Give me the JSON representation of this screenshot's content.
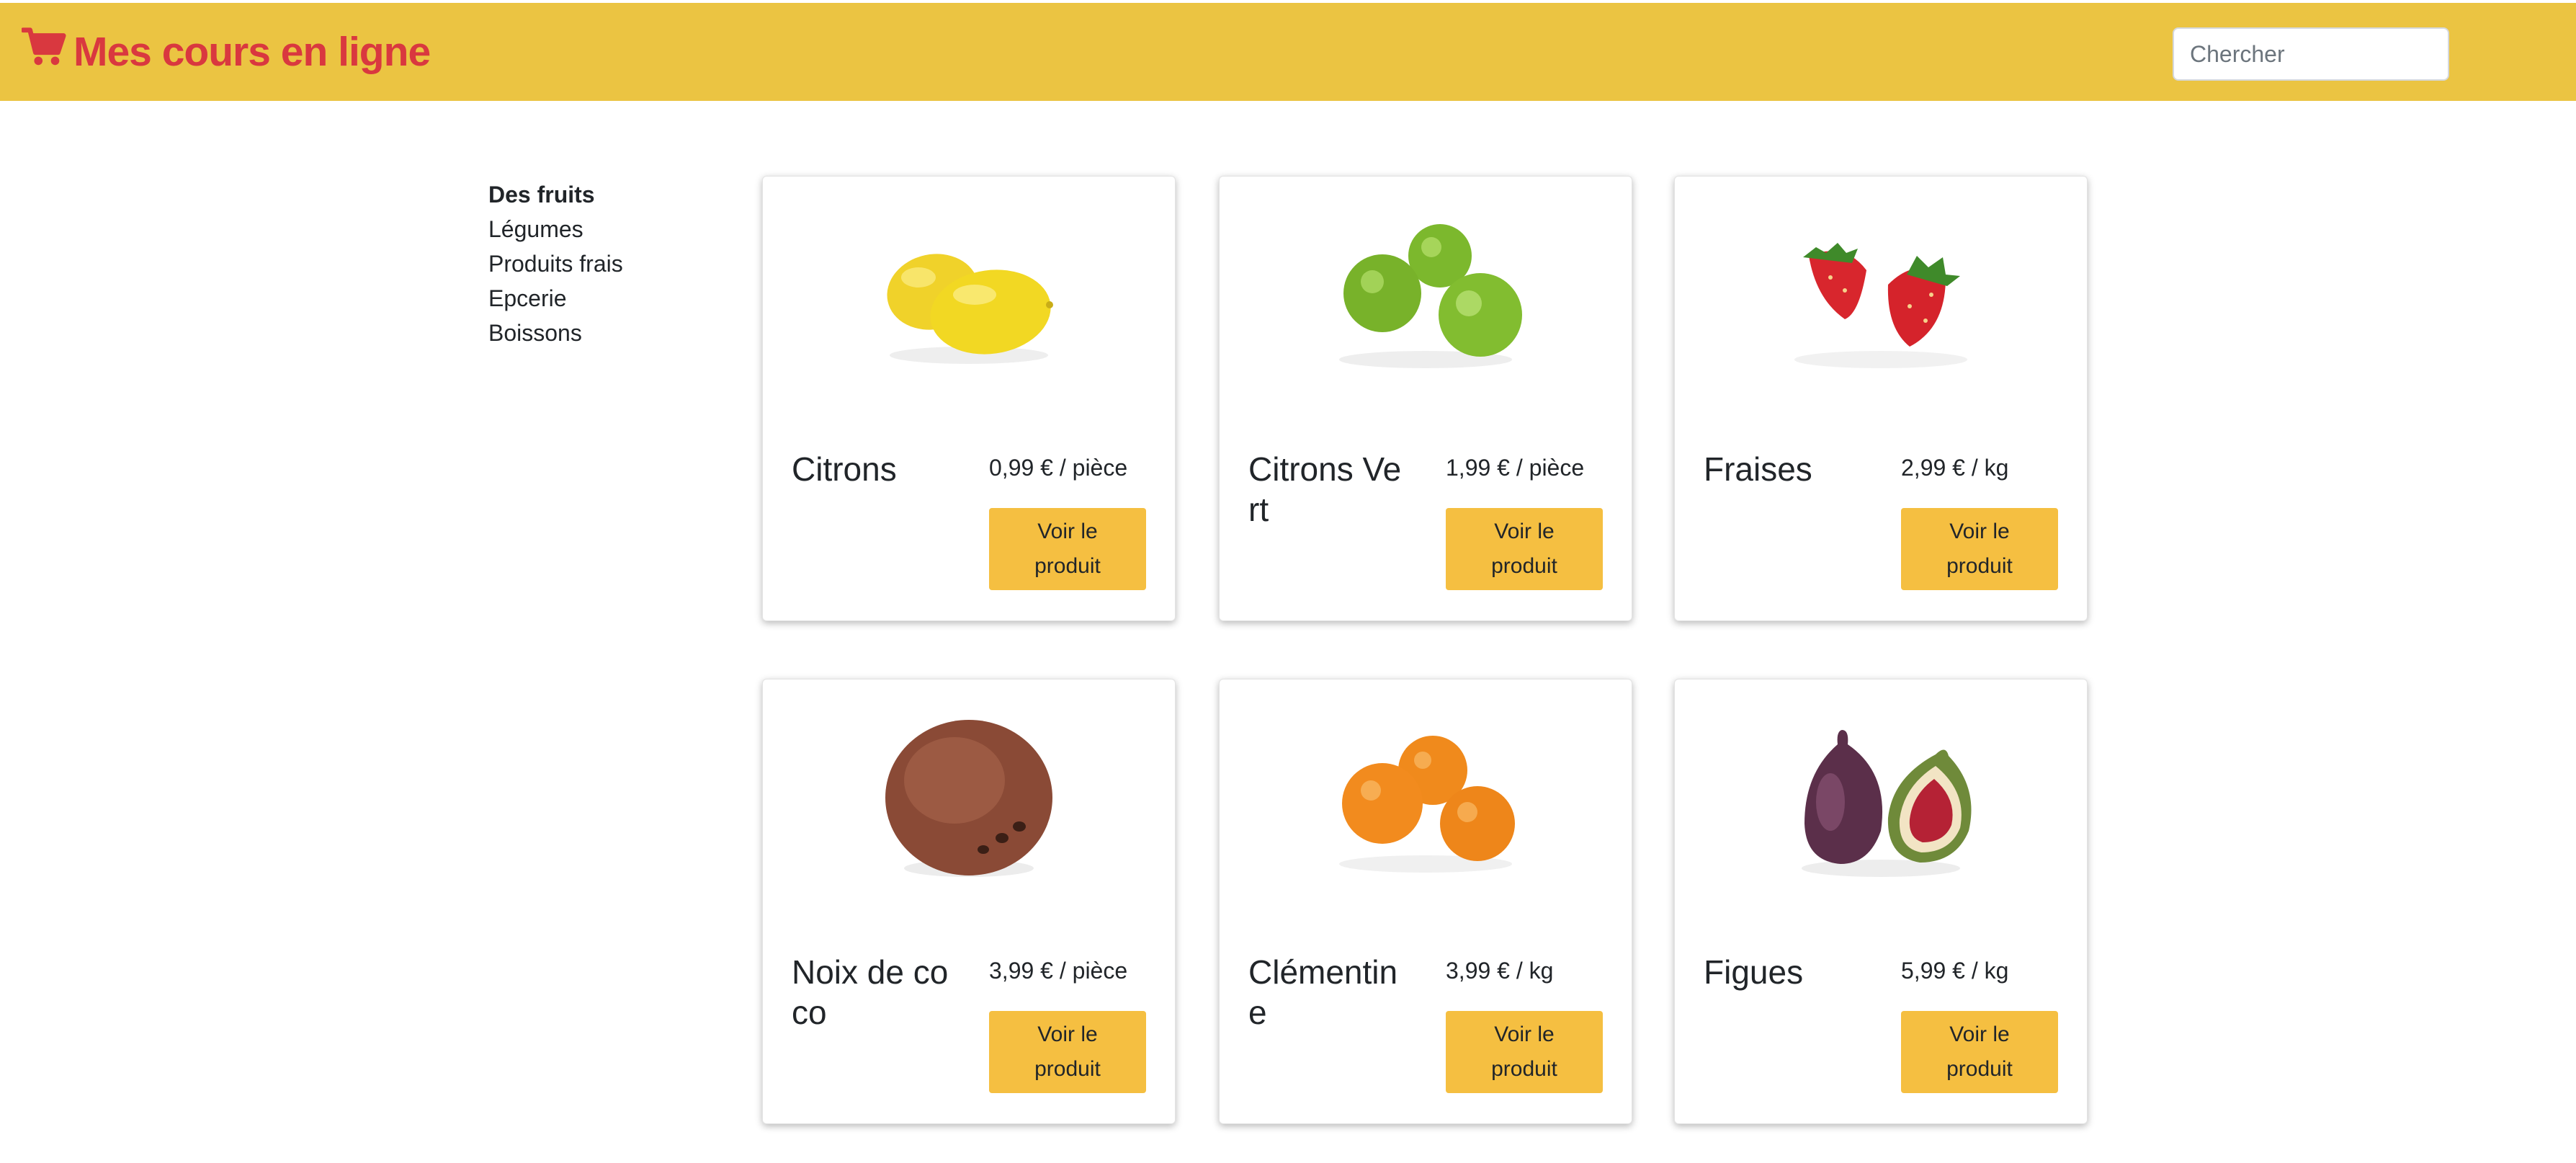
{
  "header": {
    "brand": "Mes cours en ligne",
    "brand_icon": "shopping-cart-icon",
    "search_placeholder": "Chercher",
    "search_value": "",
    "colors": {
      "bar": "#ebc442",
      "brand": "#d9383f"
    }
  },
  "sidebar": {
    "items": [
      {
        "label": "Des fruits",
        "active": true
      },
      {
        "label": "Légumes",
        "active": false
      },
      {
        "label": "Produits frais",
        "active": false
      },
      {
        "label": "Epcerie",
        "active": false
      },
      {
        "label": "Boissons",
        "active": false
      }
    ]
  },
  "products": [
    {
      "name": "Citrons",
      "price": "0,99 € / pièce",
      "button": "Voir le produit",
      "image": "lemon-image"
    },
    {
      "name": "Citrons Vert",
      "price": "1,99 € / pièce",
      "button": "Voir le produit",
      "image": "lime-image"
    },
    {
      "name": "Fraises",
      "price": "2,99 € / kg",
      "button": "Voir le produit",
      "image": "strawberry-image"
    },
    {
      "name": "Noix de coco",
      "price": "3,99 € / pièce",
      "button": "Voir le produit",
      "image": "coconut-image"
    },
    {
      "name": "Clémentine",
      "price": "3,99 € / kg",
      "button": "Voir le produit",
      "image": "clementine-image"
    },
    {
      "name": "Figues",
      "price": "5,99 € / kg",
      "button": "Voir le produit",
      "image": "fig-image"
    }
  ],
  "colors": {
    "button": "#f5bf41"
  }
}
